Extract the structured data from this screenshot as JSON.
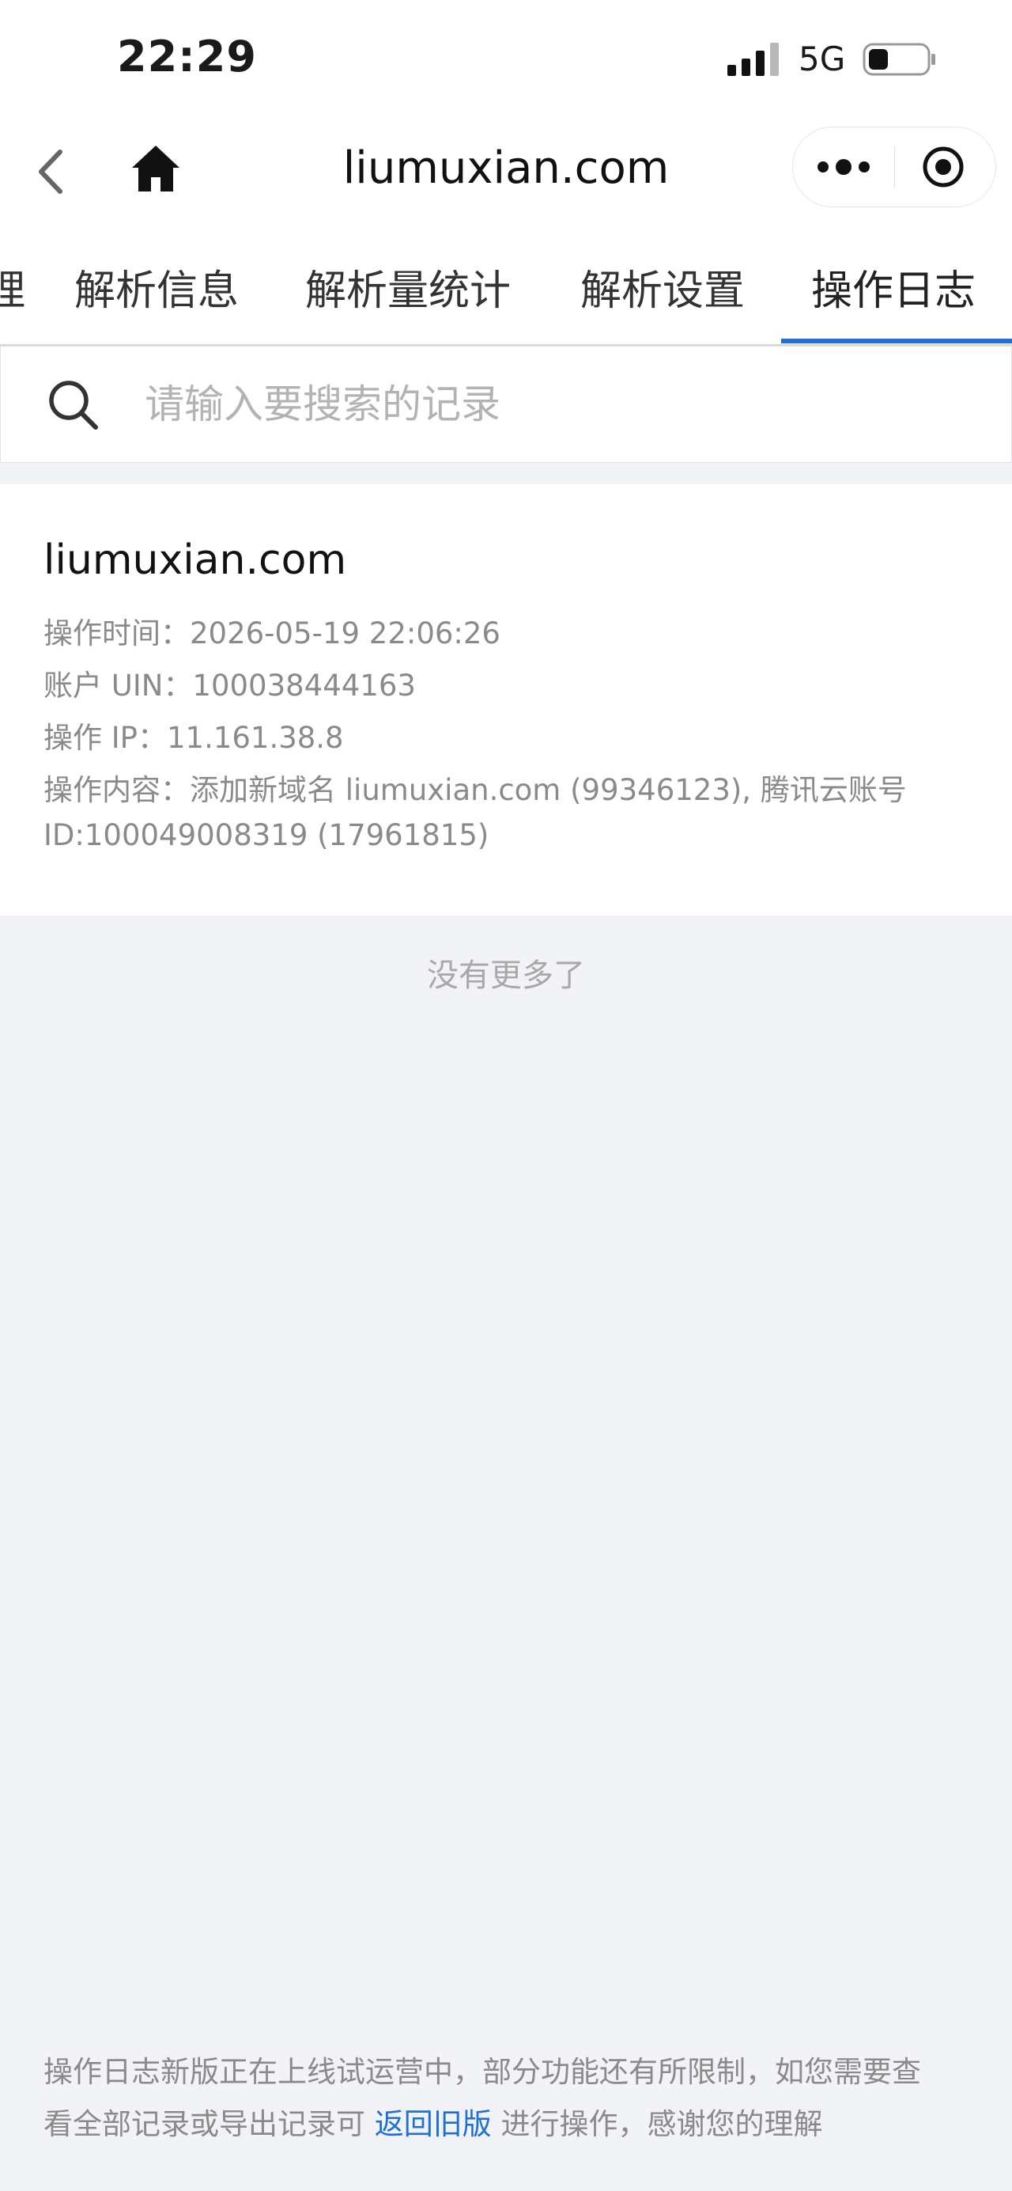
{
  "status_bar": {
    "time": "22:29",
    "network": "5G"
  },
  "nav": {
    "title": "liumuxian.com"
  },
  "tabs": [
    {
      "label": "理"
    },
    {
      "label": "解析信息"
    },
    {
      "label": "解析量统计"
    },
    {
      "label": "解析设置"
    },
    {
      "label": "操作日志",
      "active": true
    }
  ],
  "search": {
    "placeholder": "请输入要搜索的记录"
  },
  "log": {
    "domain": "liumuxian.com",
    "time_line": "操作时间：2026-05-19 22:06:26",
    "uin_line": "账户 UIN：100038444163",
    "ip_line": "操作 IP：11.161.38.8",
    "content_line1": "操作内容：添加新域名 liumuxian.com (99346123), 腾讯云账号",
    "content_line2": "ID:100049008319 (17961815)"
  },
  "list_end": "没有更多了",
  "footer": {
    "line1": "操作日志新版正在上线试运营中，部分功能还有所限制，如您需要查",
    "line2_prefix": "看全部记录或导出记录可 ",
    "link": "返回旧版",
    "line2_suffix": " 进行操作，感谢您的理解"
  },
  "colors": {
    "accent": "#1f6fd4",
    "page_background": "#f2f3f7",
    "secondary_text": "#8a8a8a"
  },
  "icons": {
    "back": "back-icon",
    "home": "home-icon",
    "more": "more-icon",
    "close": "close-miniprogram-icon",
    "search": "search-icon",
    "signal": "signal-icon",
    "battery": "battery-icon"
  }
}
